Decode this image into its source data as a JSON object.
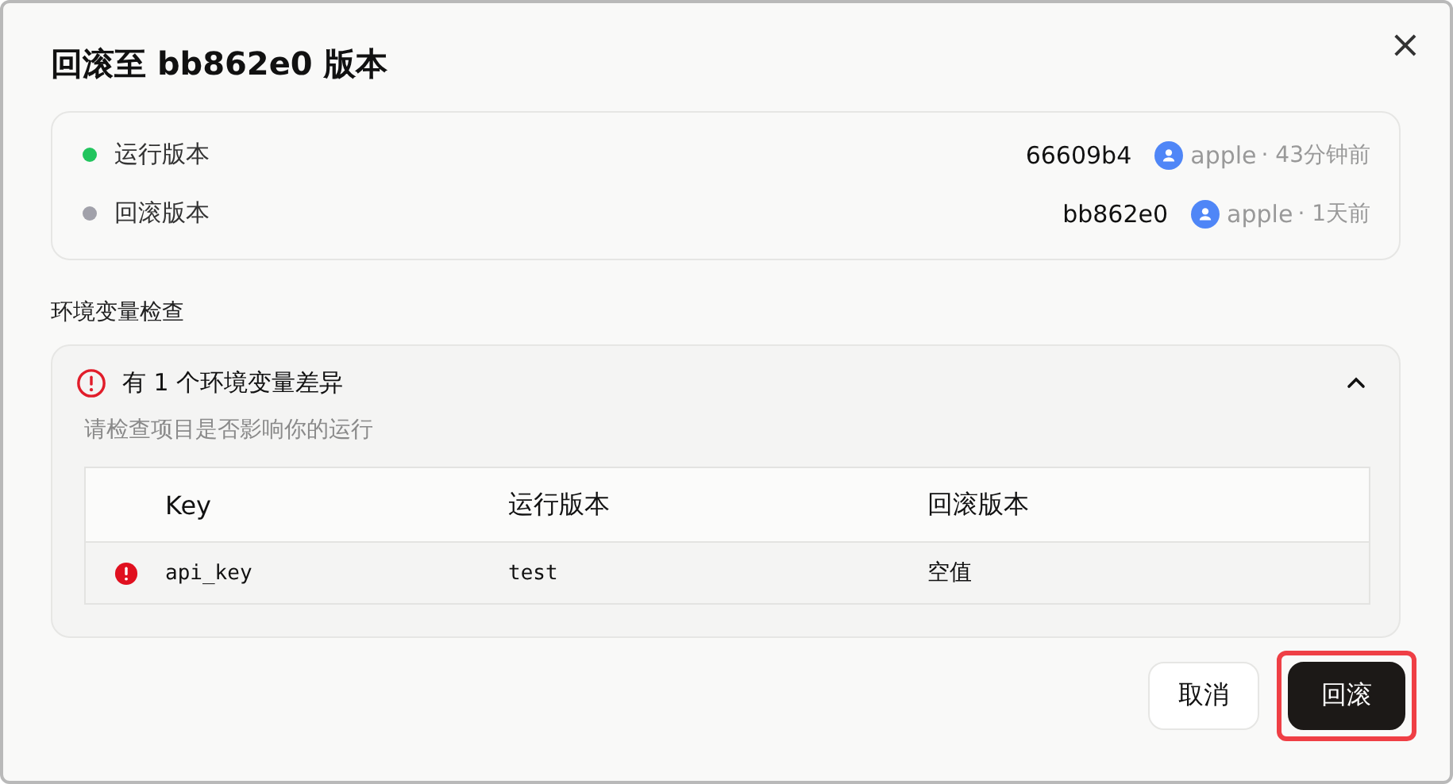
{
  "dialog": {
    "title": "回滚至 bb862e0 版本",
    "close_icon": "×"
  },
  "versions": [
    {
      "label": "运行版本",
      "color": "#22c55e",
      "hash": "66609b4",
      "user": "apple",
      "time": "· 43分钟前"
    },
    {
      "label": "回滚版本",
      "color": "#a1a1aa",
      "hash": "bb862e0",
      "user": "apple",
      "time": "· 1天前"
    }
  ],
  "env_check": {
    "heading": "环境变量检查",
    "summary": "有 1 个环境变量差异",
    "expanded": true,
    "hint": "请检查项目是否影响你的运行",
    "table": {
      "columns": [
        "Key",
        "运行版本",
        "回滚版本"
      ],
      "rows": [
        {
          "kind": "error",
          "key": "api_key",
          "current": "test",
          "rollback": "空值"
        }
      ]
    }
  },
  "buttons": [
    {
      "label": "取消",
      "kind": "secondary",
      "highlighted": false
    },
    {
      "label": "回滚",
      "kind": "primary",
      "highlighted": true
    }
  ]
}
